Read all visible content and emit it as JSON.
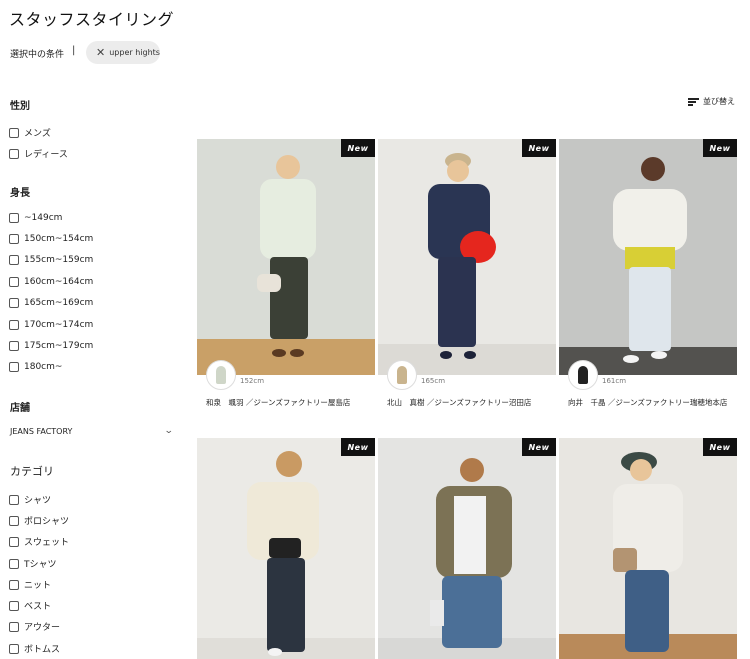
{
  "page": {
    "title": "スタッフスタイリング"
  },
  "conditions": {
    "label": "選択中の条件",
    "separator": "|",
    "chip_label": "upper hights",
    "chip_close_icon": "close-icon"
  },
  "filters": {
    "gender": {
      "heading": "性別",
      "options": [
        "メンズ",
        "レディース"
      ]
    },
    "height": {
      "heading": "身長",
      "options": [
        "~149cm",
        "150cm~154cm",
        "155cm~159cm",
        "160cm~164cm",
        "165cm~169cm",
        "170cm~174cm",
        "175cm~179cm",
        "180cm~"
      ]
    },
    "shop": {
      "heading": "店舗",
      "selected": "JEANS FACTORY",
      "icon": "chevron-down-icon"
    },
    "category": {
      "heading": "カテゴリ",
      "options": [
        "シャツ",
        "ポロシャツ",
        "スウェット",
        "Tシャツ",
        "ニット",
        "ベスト",
        "アウター",
        "ボトムス"
      ]
    }
  },
  "sort": {
    "label": "並び替え",
    "icon": "sort-icon"
  },
  "badge_label": "New",
  "cards": [
    {
      "height": "152cm",
      "staff": "和泉　颯羽 ／ジーンズファクトリー屋島店",
      "colors": {
        "bg": "#d9dcd6",
        "floor": "#c9a067",
        "top": "#e6ede0",
        "bottom": "#3b4036"
      }
    },
    {
      "height": "165cm",
      "staff": "北山　真樹 ／ジーンズファクトリー沼田店",
      "colors": {
        "bg": "#e9e8e4",
        "floor": "#dcdad5",
        "top": "#2a3553",
        "bottom": "#2b3350"
      }
    },
    {
      "height": "161cm",
      "staff": "向井　千晶 ／ジーンズファクトリー瑞穂地本店",
      "colors": {
        "bg": "#c5c6c4",
        "floor": "#53524f",
        "top": "#f1f0ea",
        "bottom": "#dfe6ec"
      }
    },
    {
      "height": "",
      "staff": "",
      "colors": {
        "bg": "#ebeae6",
        "floor": "#e0ded9",
        "top": "#efe9d8",
        "bottom": "#2c3440"
      }
    },
    {
      "height": "",
      "staff": "",
      "colors": {
        "bg": "#e4e4e2",
        "floor": "#d8d8d6",
        "top": "#7c7255",
        "bottom": "#4b6f97"
      }
    },
    {
      "height": "",
      "staff": "",
      "colors": {
        "bg": "#e8e6e1",
        "floor": "#b98a5a",
        "top": "#efede8",
        "bottom": "#3f5f86"
      }
    }
  ]
}
